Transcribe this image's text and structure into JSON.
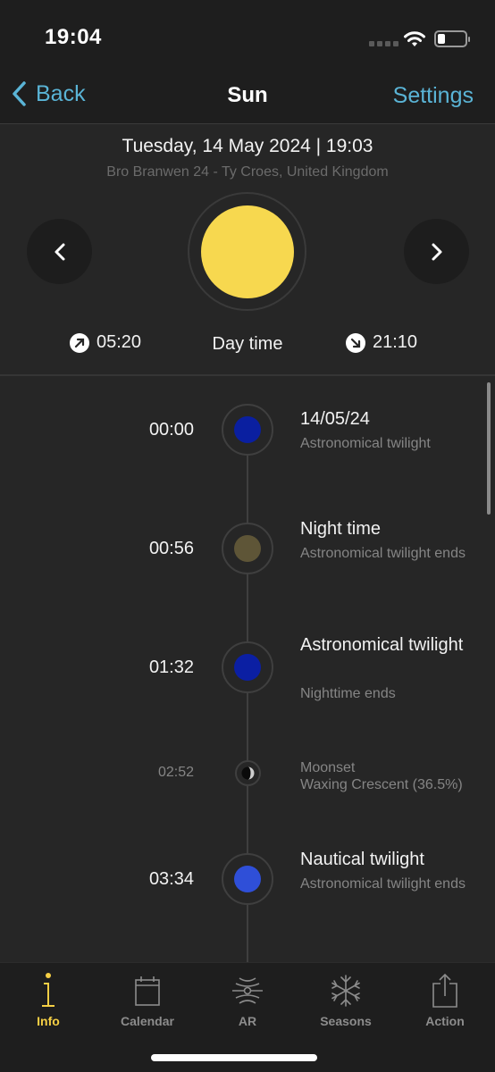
{
  "status_bar": {
    "time": "19:04",
    "wifi_icon": "wifi-icon",
    "battery_icon": "battery-low-icon"
  },
  "nav": {
    "back_label": "Back",
    "title": "Sun",
    "settings_label": "Settings"
  },
  "header": {
    "date_time": "Tuesday, 14 May 2024 | 19:03",
    "location": "Bro Branwen 24 - Ty Croes, United Kingdom",
    "sunrise": "05:20",
    "sunset": "21:10",
    "phase": "Day time",
    "sun_color": "#f7d84f"
  },
  "timeline": {
    "events": [
      {
        "time": "00:00",
        "title": "14/05/24",
        "subtitle": "Astronomical twilight",
        "color": "#0a1fa0",
        "kind": "sun"
      },
      {
        "time": "00:56",
        "title": "Night time",
        "subtitle": "Astronomical twilight ends",
        "color": "#5e5537",
        "kind": "sun"
      },
      {
        "time": "01:32",
        "title": "Astronomical twilight",
        "subtitle": "Nighttime ends",
        "color": "#0b1fa3",
        "kind": "sun"
      },
      {
        "time": "02:52",
        "title": "Moonset",
        "subtitle": "Waxing Crescent (36.5%)",
        "kind": "moon"
      },
      {
        "time": "03:34",
        "title": "Nautical twilight",
        "subtitle": "Astronomical twilight ends",
        "color": "#2f4fd8",
        "kind": "sun"
      }
    ]
  },
  "tabs": [
    {
      "label": "Info",
      "icon": "info-icon",
      "active": true
    },
    {
      "label": "Calendar",
      "icon": "calendar-icon",
      "active": false
    },
    {
      "label": "AR",
      "icon": "ar-icon",
      "active": false
    },
    {
      "label": "Seasons",
      "icon": "snowflake-icon",
      "active": false
    },
    {
      "label": "Action",
      "icon": "share-icon",
      "active": false
    }
  ],
  "colors": {
    "accent": "#5ab4d6",
    "active_tab": "#f5cf45",
    "inactive_tab": "#8c8c8c"
  }
}
